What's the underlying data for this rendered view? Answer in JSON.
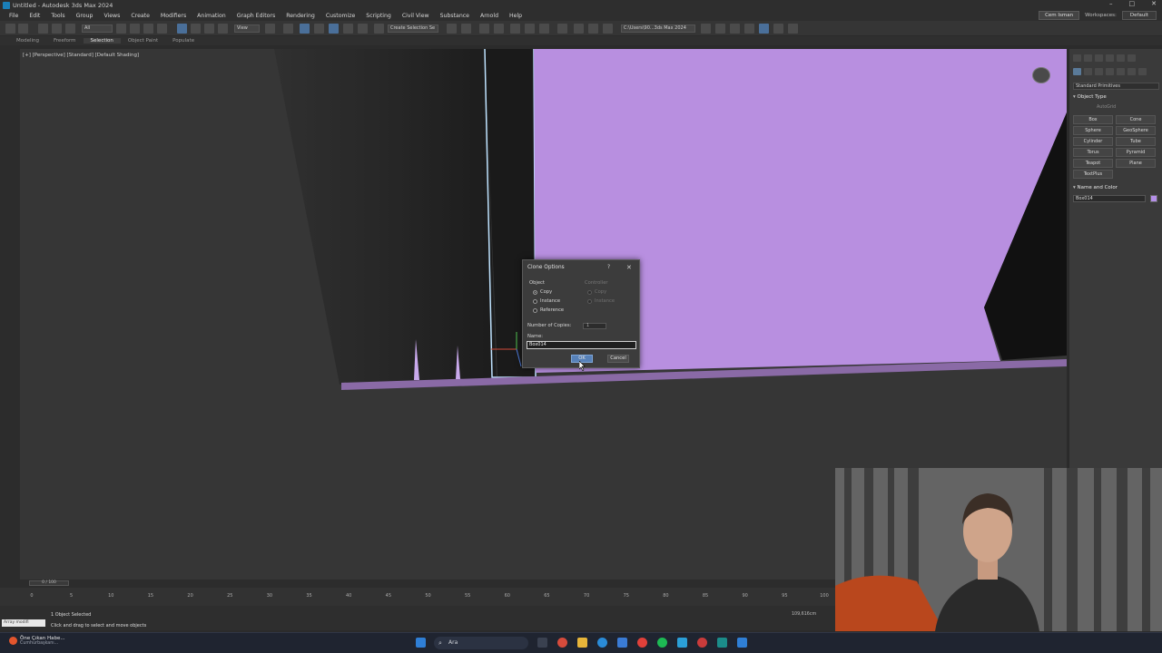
{
  "window": {
    "title": "Untitled - Autodesk 3ds Max 2024",
    "controls": [
      "–",
      "□",
      "✕"
    ]
  },
  "menu": {
    "items": [
      "File",
      "Edit",
      "Tools",
      "Group",
      "Views",
      "Create",
      "Modifiers",
      "Animation",
      "Graph Editors",
      "Rendering",
      "Customize",
      "Scripting",
      "Civil View",
      "Substance",
      "Arnold",
      "Help"
    ],
    "user": "Cem Isman",
    "workspaces_label": "Workspaces:",
    "workspace_value": "Default"
  },
  "toolbar": {
    "filter_all": "All",
    "view_select": "View",
    "selection_set": "Create Selection Se",
    "project_path": "C:\\Users\\90...3ds Max 2024"
  },
  "ribbon": {
    "tabs": [
      "Modeling",
      "Freeform",
      "Selection",
      "Object Paint",
      "Populate"
    ],
    "active": "Selection"
  },
  "viewport": {
    "label": "[+] [Perspective] [Standard] [Default Shading]",
    "colors": {
      "wall": "#b88fe0",
      "floor_edge": "#8a6aa6",
      "background": "#363636"
    }
  },
  "command_panel": {
    "category": "Standard Primitives",
    "object_type_header": "Object Type",
    "autogrid": "AutoGrid",
    "buttons": [
      "Box",
      "Cone",
      "Sphere",
      "GeoSphere",
      "Cylinder",
      "Tube",
      "Torus",
      "Pyramid",
      "Teapot",
      "Plane",
      "TextPlus"
    ],
    "name_color_header": "Name and Color",
    "name_value": "Box014",
    "swatch_color": "#b48fe8"
  },
  "dialog": {
    "title": "Clone Options",
    "help": "?",
    "close": "✕",
    "object_group": "Object",
    "object_options": [
      {
        "label": "Copy",
        "selected": true
      },
      {
        "label": "Instance",
        "selected": false
      },
      {
        "label": "Reference",
        "selected": false
      }
    ],
    "controller_group": "Controller",
    "controller_options": [
      {
        "label": "Copy",
        "selected": true
      },
      {
        "label": "Instance",
        "selected": false
      }
    ],
    "copies_label": "Number of Copies:",
    "copies_value": "1",
    "name_label": "Name:",
    "name_value": "Box014",
    "ok": "OK",
    "cancel": "Cancel"
  },
  "timeline": {
    "slider": "0 / 100",
    "ticks": [
      "0",
      "5",
      "10",
      "15",
      "20",
      "25",
      "30",
      "35",
      "40",
      "45",
      "50",
      "55",
      "60",
      "65",
      "70",
      "75",
      "80",
      "85",
      "90",
      "95",
      "100"
    ]
  },
  "status": {
    "selected": "1 Object Selected",
    "hint": "Click and drag to select and move objects",
    "maxscript": "Array modifi",
    "grid": "109,616cm"
  },
  "taskbar": {
    "news_title": "Öne Çıkan Habe...",
    "news_sub": "Cumhurbaşkanı...",
    "search": "Ara"
  }
}
